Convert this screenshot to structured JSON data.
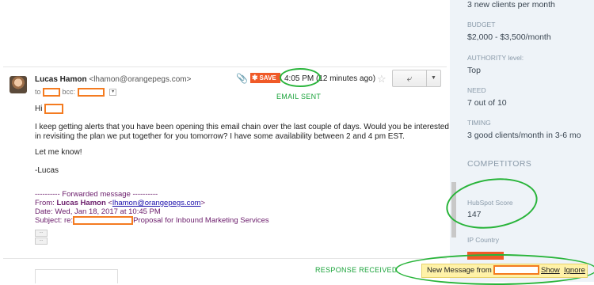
{
  "email": {
    "sender_name": "Lucas Hamon",
    "sender_email": "<lhamon@orangepegs.com>",
    "save_label": "SAVE",
    "time": "4:05 PM (12 minutes ago)",
    "to_label": "to",
    "bcc_label": "bcc:",
    "body": {
      "greeting": "Hi",
      "line1": "I keep getting alerts that you have been opening this email chain over the last couple of days. Would you be interested",
      "line2": "in revisiting the plan we put together for you tomorrow? I have some availability between 2 and 4 pm EST.",
      "line3": "Let me know!",
      "sign": "-Lucas"
    },
    "forwarded": {
      "header": "---------- Forwarded message ----------",
      "from_label": "From:",
      "from_name": "Lucas Hamon",
      "from_email_prefix": "<",
      "from_email": "lhamon@orangepegs.com",
      "from_email_suffix": ">",
      "date": "Date: Wed, Jan 18, 2017 at 10:45 PM",
      "subject_prefix": "Subject: re:",
      "subject_suffix": "Proposal for Inbound Marketing Services"
    },
    "dots": "..."
  },
  "annotations": {
    "email_sent": "EMAIL SENT",
    "response_received": "RESPONSE RECEIVED"
  },
  "sidebar": {
    "clients_value": "3 new clients per month",
    "budget_label": "BUDGET",
    "budget_value": "$2,000 - $3,500/month",
    "authority_label": "AUTHORITY level:",
    "authority_value": "Top",
    "need_label": "NEED",
    "need_value": "7 out of 10",
    "timing_label": "TIMING",
    "timing_value": "3 good clients/month in 3-6 mo",
    "competitors_heading": "COMPETITORS",
    "hubspot_label": "HubSpot Score",
    "hubspot_value": "147",
    "ip_label": "IP Country"
  },
  "notification": {
    "message": "New Message from",
    "show": "Show",
    "ignore": "Ignore"
  },
  "colors": {
    "hubspot_orange": "#f05a28",
    "annotation_green": "#28b43a",
    "redaction_orange": "#f47b20"
  },
  "icons": [
    "paperclip-icon",
    "hubspot-sprocket-icon",
    "star-icon",
    "reply-arrow-icon",
    "dropdown-caret-icon"
  ]
}
